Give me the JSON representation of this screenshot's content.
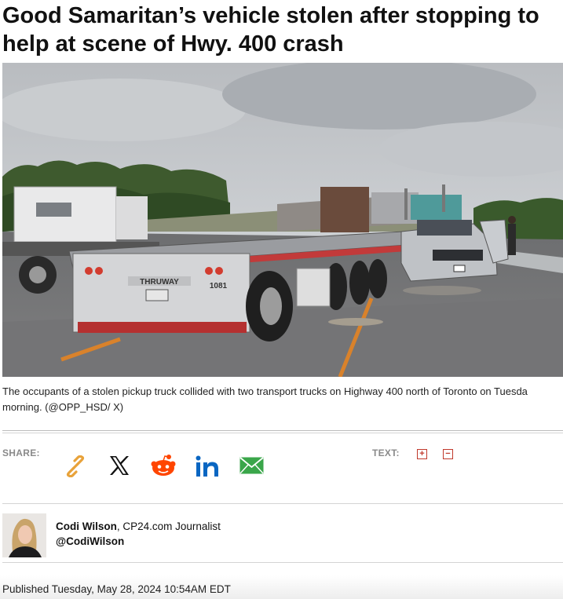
{
  "article": {
    "headline_line1": "Good Samaritan’s vehicle stolen after stopping to",
    "headline_line2": "help at scene of Hwy. 400 crash",
    "photo": {
      "trailer_brand": "THRUWAY",
      "trailer_number": "1081"
    },
    "caption_line1": "The occupants of a stolen pickup truck collided with two transport trucks on Highway 400 north of Toronto on Tuesda",
    "caption_line2": "morning. (@OPP_HSD/ X)"
  },
  "share": {
    "label": "SHARE:",
    "icons": [
      "link-icon",
      "x-icon",
      "reddit-icon",
      "linkedin-icon",
      "email-icon"
    ],
    "text_label": "TEXT:",
    "increase_label": "+",
    "decrease_label": "−"
  },
  "author": {
    "name": "Codi Wilson",
    "title": ", CP24.com Journalist",
    "handle": "@CodiWilson"
  },
  "published": "Published Tuesday, May 28, 2024 10:54AM EDT",
  "colors": {
    "link_icon": "#e8a23a",
    "reddit": "#ff4500",
    "linkedin": "#0a66c2",
    "email": "#3aa64a",
    "text_size_controls": "#c0392b"
  }
}
